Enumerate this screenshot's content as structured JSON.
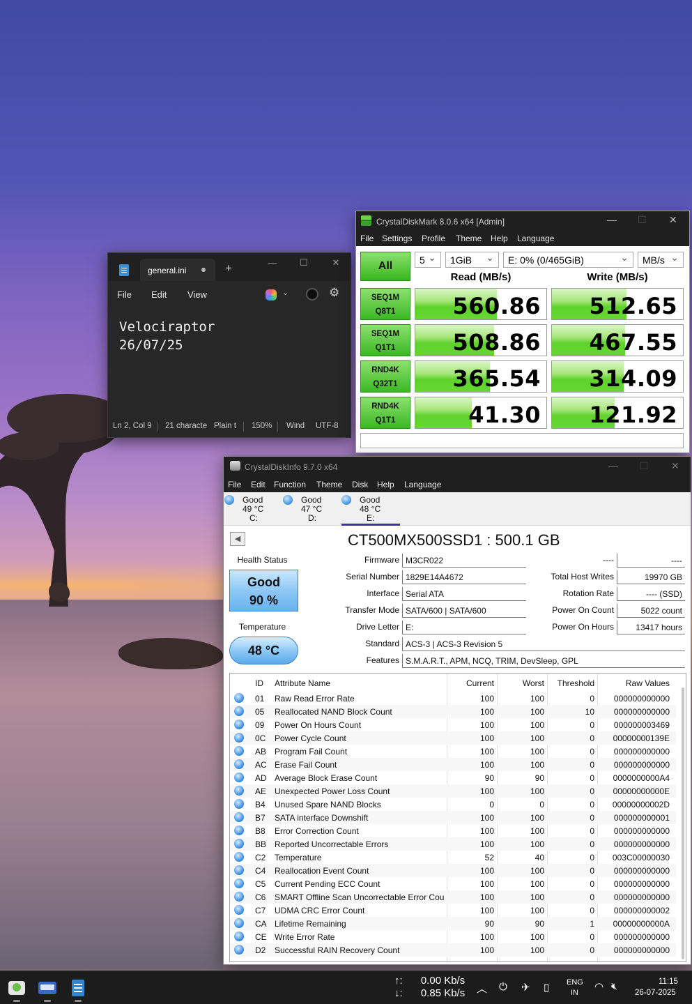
{
  "notepad": {
    "tab_title": "general.ini",
    "menu": [
      "File",
      "Edit",
      "View"
    ],
    "content_line1": "Velociraptor",
    "content_line2": "26/07/25",
    "status": {
      "position": "Ln 2, Col 9",
      "chars": "21 characte",
      "format": "Plain t",
      "zoom": "150%",
      "line_ending": "Wind",
      "encoding": "UTF-8"
    }
  },
  "cdm": {
    "title": "CrystalDiskMark 8.0.6 x64 [Admin]",
    "menu": [
      "File",
      "Settings",
      "Profile",
      "Theme",
      "Help",
      "Language"
    ],
    "all_label": "All",
    "count": "5",
    "size": "1GiB",
    "drive": "E: 0% (0/465GiB)",
    "unit": "MB/s",
    "read_header": "Read (MB/s)",
    "write_header": "Write (MB/s)",
    "tests": [
      {
        "line1": "SEQ1M",
        "line2": "Q8T1",
        "read": "560.86",
        "write": "512.65",
        "read_fill": 0.62,
        "write_fill": 0.57
      },
      {
        "line1": "SEQ1M",
        "line2": "Q1T1",
        "read": "508.86",
        "write": "467.55",
        "read_fill": 0.6,
        "write_fill": 0.56
      },
      {
        "line1": "RND4K",
        "line2": "Q32T1",
        "read": "365.54",
        "write": "314.09",
        "read_fill": 0.57,
        "write_fill": 0.55
      },
      {
        "line1": "RND4K",
        "line2": "Q1T1",
        "read": "41.30",
        "write": "121.92",
        "read_fill": 0.43,
        "write_fill": 0.48
      }
    ]
  },
  "cdi": {
    "title": "CrystalDiskInfo 9.7.0 x64",
    "menu": [
      "File",
      "Edit",
      "Function",
      "Theme",
      "Disk",
      "Help",
      "Language"
    ],
    "disks": [
      {
        "status": "Good",
        "temp": "49 °C",
        "letter": "C:"
      },
      {
        "status": "Good",
        "temp": "47 °C",
        "letter": "D:"
      },
      {
        "status": "Good",
        "temp": "48 °C",
        "letter": "E:"
      }
    ],
    "model": "CT500MX500SSD1 : 500.1 GB",
    "health_label": "Health Status",
    "health_status": "Good",
    "health_pct": "90 %",
    "temp_label": "Temperature",
    "temp_value": "48 °C",
    "fields": {
      "firmware_label": "Firmware",
      "firmware": "M3CR022",
      "serial_label": "Serial Number",
      "serial": "1829E14A4672",
      "interface_label": "Interface",
      "interface": "Serial ATA",
      "transfer_label": "Transfer Mode",
      "transfer": "SATA/600 | SATA/600",
      "letter_label": "Drive Letter",
      "letter": "E:",
      "standard_label": "Standard",
      "standard": "ACS-3 | ACS-3 Revision 5",
      "features_label": "Features",
      "features": "S.M.A.R.T., APM, NCQ, TRIM, DevSleep, GPL",
      "dash_label": "----",
      "dash_value": "----",
      "host_writes_label": "Total Host Writes",
      "host_writes": "19970 GB",
      "rotation_label": "Rotation Rate",
      "rotation": "---- (SSD)",
      "power_count_label": "Power On Count",
      "power_count": "5022 count",
      "power_hours_label": "Power On Hours",
      "power_hours": "13417 hours"
    },
    "smart_headers": [
      "ID",
      "Attribute Name",
      "Current",
      "Worst",
      "Threshold",
      "Raw Values"
    ],
    "smart_rows": [
      [
        "01",
        "Raw Read Error Rate",
        "100",
        "100",
        "0",
        "000000000000"
      ],
      [
        "05",
        "Reallocated NAND Block Count",
        "100",
        "100",
        "10",
        "000000000000"
      ],
      [
        "09",
        "Power On Hours Count",
        "100",
        "100",
        "0",
        "000000003469"
      ],
      [
        "0C",
        "Power Cycle Count",
        "100",
        "100",
        "0",
        "00000000139E"
      ],
      [
        "AB",
        "Program Fail Count",
        "100",
        "100",
        "0",
        "000000000000"
      ],
      [
        "AC",
        "Erase Fail Count",
        "100",
        "100",
        "0",
        "000000000000"
      ],
      [
        "AD",
        "Average Block Erase Count",
        "90",
        "90",
        "0",
        "0000000000A4"
      ],
      [
        "AE",
        "Unexpected Power Loss Count",
        "100",
        "100",
        "0",
        "00000000000E"
      ],
      [
        "B4",
        "Unused Spare NAND Blocks",
        "0",
        "0",
        "0",
        "00000000002D"
      ],
      [
        "B7",
        "SATA interface Downshift",
        "100",
        "100",
        "0",
        "000000000001"
      ],
      [
        "B8",
        "Error Correction Count",
        "100",
        "100",
        "0",
        "000000000000"
      ],
      [
        "BB",
        "Reported Uncorrectable Errors",
        "100",
        "100",
        "0",
        "000000000000"
      ],
      [
        "C2",
        "Temperature",
        "52",
        "40",
        "0",
        "003C00000030"
      ],
      [
        "C4",
        "Reallocation Event Count",
        "100",
        "100",
        "0",
        "000000000000"
      ],
      [
        "C5",
        "Current Pending ECC Count",
        "100",
        "100",
        "0",
        "000000000000"
      ],
      [
        "C6",
        "SMART Offline Scan Uncorrectable Error Cou...",
        "100",
        "100",
        "0",
        "000000000000"
      ],
      [
        "C7",
        "UDMA CRC Error Count",
        "100",
        "100",
        "0",
        "000000000002"
      ],
      [
        "CA",
        "Lifetime Remaining",
        "90",
        "90",
        "1",
        "00000000000A"
      ],
      [
        "CE",
        "Write Error Rate",
        "100",
        "100",
        "0",
        "000000000000"
      ],
      [
        "D2",
        "Successful RAIN Recovery Count",
        "100",
        "100",
        "0",
        "000000000000"
      ]
    ]
  },
  "taskbar": {
    "net_up_arrow": "↑:",
    "net_up": "0.00 Kb/s",
    "net_down_arrow": "↓:",
    "net_down": "0.85 Kb/s",
    "lang": "ENG",
    "region": "IN",
    "time": "11:15",
    "date": "26-07-2025"
  }
}
